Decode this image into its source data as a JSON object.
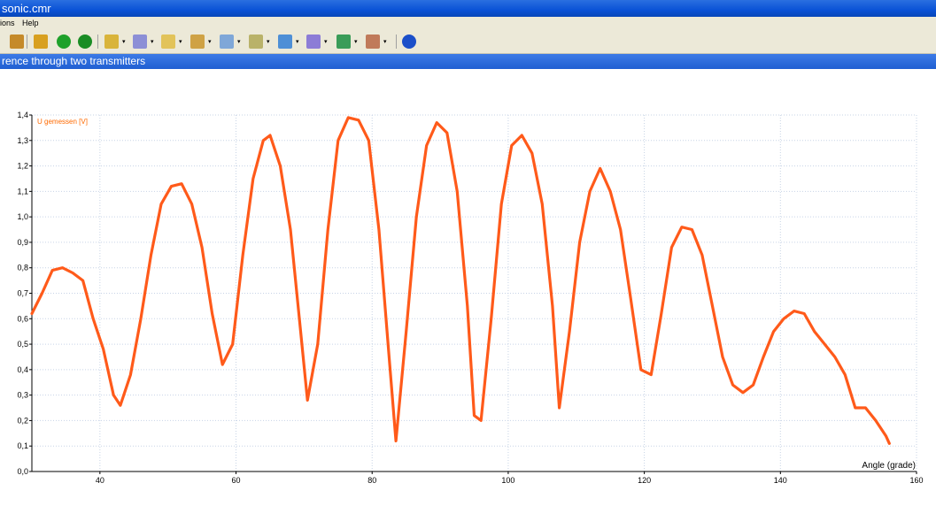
{
  "window": {
    "title": "sonic.cmr"
  },
  "menu": {
    "items": [
      "ions",
      "Help"
    ]
  },
  "toolbar": {
    "buttons": [
      {
        "name": "ear-icon",
        "color": "#c58a2a"
      },
      {
        "name": "stopwatch-icon",
        "color": "#d8a020"
      },
      {
        "name": "play-icon",
        "color": "#1fa12a"
      },
      {
        "name": "power-icon",
        "color": "#1a8c24"
      },
      {
        "name": "triangle-tool-icon",
        "color": "#d9b43b"
      },
      {
        "name": "numbers-tool-icon",
        "color": "#8c8fd6"
      },
      {
        "name": "folder-tool-icon",
        "color": "#e2c35a"
      },
      {
        "name": "table-tool-icon",
        "color": "#cfa245"
      },
      {
        "name": "graph-tool-icon",
        "color": "#7fa7d8"
      },
      {
        "name": "list-tool-icon",
        "color": "#b9b269"
      },
      {
        "name": "image-tool-icon",
        "color": "#4e8fd6"
      },
      {
        "name": "meter-tool-icon",
        "color": "#8c7cd6"
      },
      {
        "name": "globe-tool-icon",
        "color": "#3a9c58"
      },
      {
        "name": "chart-tool-icon",
        "color": "#c07a5a"
      },
      {
        "name": "help-icon",
        "color": "#1b4fc9"
      }
    ]
  },
  "panel": {
    "title": "rence through two transmitters"
  },
  "colors": {
    "series": "#ff5a1a",
    "grid": "#c7d3e6",
    "accent": "#0a52d6"
  },
  "chart_data": {
    "type": "line",
    "title": "",
    "xlabel": "Angle (grade)",
    "ylabel": "",
    "xlim": [
      30,
      160
    ],
    "ylim": [
      0.0,
      1.4
    ],
    "xticks": [
      40,
      60,
      80,
      100,
      120,
      140,
      160
    ],
    "yticks": [
      0.0,
      0.1,
      0.2,
      0.3,
      0.4,
      0.5,
      0.6,
      0.7,
      0.8,
      0.9,
      1.0,
      1.1,
      1.2,
      1.3,
      1.4
    ],
    "xtick_labels": [
      "40",
      "60",
      "80",
      "100",
      "120",
      "140",
      "160"
    ],
    "ytick_labels": [
      "0,0",
      "0,1",
      "0,2",
      "0,3",
      "0,4",
      "0,5",
      "0,6",
      "0,7",
      "0,8",
      "0,9",
      "1,0",
      "1,1",
      "1,2",
      "1,3",
      "1,4"
    ],
    "grid": true,
    "series": [
      {
        "name": "U gemessen [V]",
        "color": "#ff5a1a",
        "x": [
          30,
          31.5,
          33,
          34.5,
          36,
          37.5,
          39,
          40.5,
          42,
          43,
          44.5,
          46,
          47.5,
          49,
          50.5,
          52,
          53.5,
          55,
          56.5,
          58,
          59.5,
          61,
          62.5,
          64,
          65,
          66.5,
          68,
          69.5,
          70.5,
          72,
          73.5,
          75,
          76.5,
          78,
          79.5,
          81,
          82.5,
          83.5,
          85,
          86.5,
          88,
          89.5,
          91,
          92.5,
          94,
          95,
          96,
          97.5,
          99,
          100.5,
          102,
          103.5,
          105,
          106.5,
          107.5,
          109,
          110.5,
          112,
          113.5,
          115,
          116.5,
          118,
          119.5,
          121,
          122.5,
          124,
          125.5,
          127,
          128.5,
          130,
          131.5,
          133,
          134.5,
          136,
          137.5,
          139,
          140.5,
          142,
          143.5,
          145,
          146.5,
          148,
          149.5,
          151,
          152.5,
          154,
          155.5,
          156
        ],
        "y": [
          0.62,
          0.7,
          0.79,
          0.8,
          0.78,
          0.75,
          0.6,
          0.48,
          0.3,
          0.26,
          0.38,
          0.6,
          0.85,
          1.05,
          1.12,
          1.13,
          1.05,
          0.88,
          0.62,
          0.42,
          0.5,
          0.85,
          1.15,
          1.3,
          1.32,
          1.2,
          0.95,
          0.55,
          0.28,
          0.5,
          0.95,
          1.3,
          1.39,
          1.38,
          1.3,
          0.95,
          0.45,
          0.12,
          0.55,
          1.0,
          1.28,
          1.37,
          1.33,
          1.1,
          0.65,
          0.22,
          0.2,
          0.6,
          1.05,
          1.28,
          1.32,
          1.25,
          1.05,
          0.65,
          0.25,
          0.55,
          0.9,
          1.1,
          1.19,
          1.1,
          0.95,
          0.68,
          0.4,
          0.38,
          0.62,
          0.88,
          0.96,
          0.95,
          0.85,
          0.65,
          0.45,
          0.34,
          0.31,
          0.34,
          0.45,
          0.55,
          0.6,
          0.63,
          0.62,
          0.55,
          0.5,
          0.45,
          0.38,
          0.25,
          0.25,
          0.2,
          0.14,
          0.11
        ]
      }
    ]
  }
}
